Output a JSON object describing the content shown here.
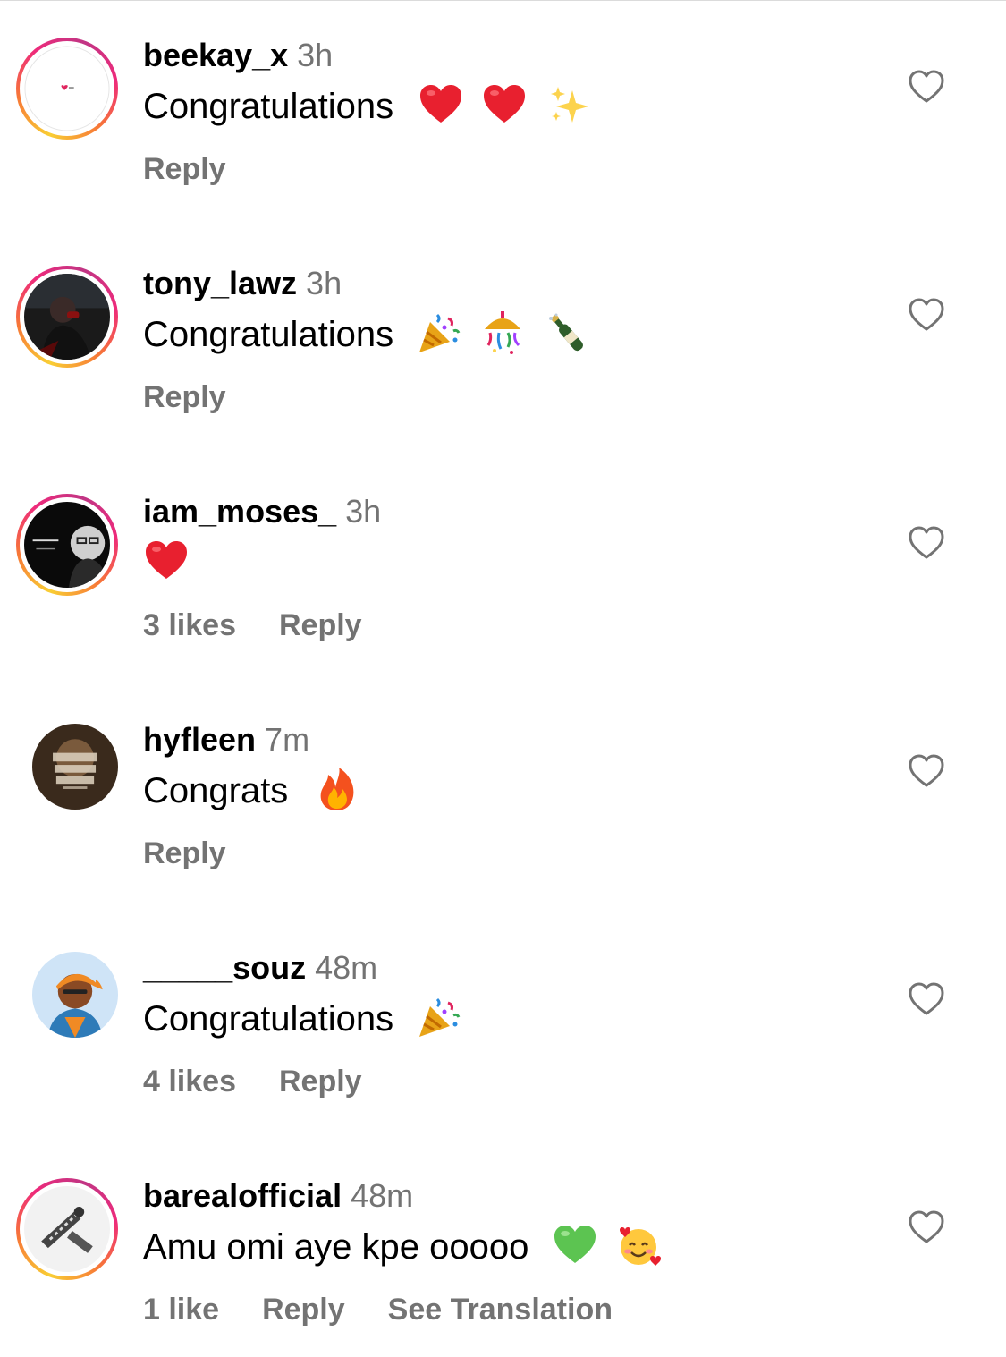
{
  "comments": [
    {
      "username": "beekay_x",
      "time": "3h",
      "text": "Congratulations",
      "emojis": [
        "red-heart",
        "red-heart",
        "sparkles"
      ],
      "likes": "",
      "reply_label": "Reply",
      "translate_label": "",
      "avatar": "story-ring-white-avatar"
    },
    {
      "username": "tony_lawz",
      "time": "3h",
      "text": "Congratulations",
      "emojis": [
        "party-popper",
        "confetti-ball",
        "champagne"
      ],
      "likes": "",
      "reply_label": "Reply",
      "translate_label": "",
      "avatar": "story-ring-dark-photo-avatar"
    },
    {
      "username": "iam_moses_",
      "time": "3h",
      "text": "",
      "emojis": [
        "red-heart"
      ],
      "likes": "3 likes",
      "reply_label": "Reply",
      "translate_label": "",
      "avatar": "story-ring-cinema-avatar"
    },
    {
      "username": "hyfleen",
      "time": "7m",
      "text": "Congrats",
      "emojis": [
        "fire"
      ],
      "likes": "",
      "reply_label": "Reply",
      "translate_label": "",
      "avatar": "need-more-cash-avatar"
    },
    {
      "username": "_____souz",
      "time": "48m",
      "text": "Congratulations",
      "emojis": [
        "party-popper"
      ],
      "likes": "4 likes",
      "reply_label": "Reply",
      "translate_label": "",
      "avatar": "illustrated-person-avatar"
    },
    {
      "username": "barealofficial",
      "time": "48m",
      "text": "Amu omi aye kpe ooooo",
      "emojis": [
        "green-heart",
        "smiling-face-with-hearts"
      ],
      "likes": "1 like",
      "reply_label": "Reply",
      "translate_label": "See Translation",
      "avatar": "story-ring-logo-avatar"
    }
  ],
  "colors": {
    "secondary_text": "#737373",
    "ring_gradient": [
      "#f9ce34",
      "#ee2a7b",
      "#c13584"
    ]
  }
}
